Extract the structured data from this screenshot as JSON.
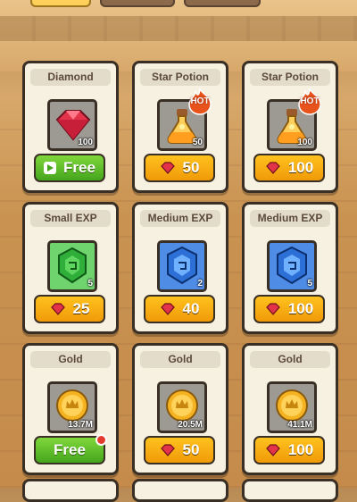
{
  "colors": {
    "button_orange": "#f5a90f",
    "button_green": "#5fbf2a",
    "card_bg": "#f7f1e2",
    "hot_badge": "#e8531c"
  },
  "shop": {
    "items": [
      {
        "title": "Diamond",
        "icon": "ruby-icon",
        "qty": "100",
        "price_type": "free",
        "price": "Free"
      },
      {
        "title": "Star Potion",
        "icon": "potion-icon",
        "qty": "50",
        "hot": "HOT",
        "price_type": "ruby",
        "price": "50"
      },
      {
        "title": "Star Potion",
        "icon": "potion-icon",
        "qty": "100",
        "hot": "HOT",
        "price_type": "ruby",
        "price": "100"
      },
      {
        "title": "Small EXP",
        "icon": "green-gem-icon",
        "qty": "5",
        "price_type": "ruby",
        "price": "25"
      },
      {
        "title": "Medium EXP",
        "icon": "blue-gem-icon",
        "qty": "2",
        "price_type": "ruby",
        "price": "40"
      },
      {
        "title": "Medium EXP",
        "icon": "blue-gem-icon",
        "qty": "5",
        "price_type": "ruby",
        "price": "100"
      },
      {
        "title": "Gold",
        "icon": "gold-coin-icon",
        "qty": "13.7M",
        "price_type": "free",
        "price": "Free",
        "notification": true
      },
      {
        "title": "Gold",
        "icon": "gold-coin-icon",
        "qty": "20.5M",
        "price_type": "ruby",
        "price": "50"
      },
      {
        "title": "Gold",
        "icon": "gold-coin-icon",
        "qty": "41.1M",
        "price_type": "ruby",
        "price": "100"
      }
    ]
  }
}
